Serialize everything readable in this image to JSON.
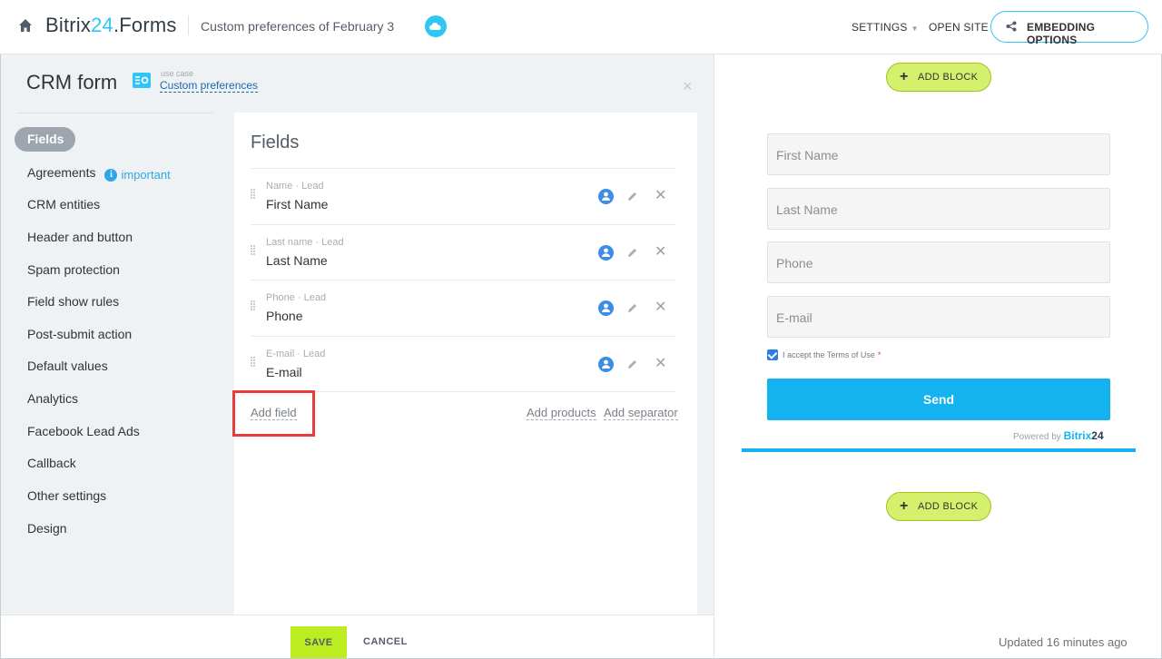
{
  "topbar": {
    "brand_main": "Bitrix",
    "brand_accent": "24",
    "brand_suffix": ".Forms",
    "doc_title": "Custom preferences of February 3",
    "settings_label": "SETTINGS",
    "open_site_label": "OPEN SITE",
    "embedding_label": "EMBEDDING OPTIONS"
  },
  "editor": {
    "title": "CRM form",
    "usecase_small": "use case",
    "usecase_link": "Custom preferences",
    "close_glyph": "×"
  },
  "nav": {
    "items": [
      {
        "label": "Fields",
        "active": true
      },
      {
        "label": "Agreements",
        "badge": "important"
      },
      {
        "label": "CRM entities"
      },
      {
        "label": "Header and button"
      },
      {
        "label": "Spam protection"
      },
      {
        "label": "Field show rules"
      },
      {
        "label": "Post-submit action"
      },
      {
        "label": "Default values"
      },
      {
        "label": "Analytics"
      },
      {
        "label": "Facebook Lead Ads"
      },
      {
        "label": "Callback"
      },
      {
        "label": "Other settings"
      },
      {
        "label": "Design"
      }
    ]
  },
  "fields_card": {
    "title": "Fields",
    "rows": [
      {
        "sub": "Name · Lead",
        "main": "First Name"
      },
      {
        "sub": "Last name · Lead",
        "main": "Last Name"
      },
      {
        "sub": "Phone · Lead",
        "main": "Phone"
      },
      {
        "sub": "E-mail · Lead",
        "main": "E-mail"
      }
    ],
    "add_field": "Add field",
    "add_products": "Add products",
    "add_separator": "Add separator"
  },
  "footer": {
    "save": "SAVE",
    "cancel": "CANCEL"
  },
  "preview": {
    "add_block": "ADD BLOCK",
    "inputs": [
      "First Name",
      "Last Name",
      "Phone",
      "E-mail"
    ],
    "terms": "I accept the Terms of Use",
    "terms_required": "*",
    "send": "Send",
    "powered_prefix": "Powered by",
    "powered_brand": "Bitrix",
    "powered_num": "24",
    "updated": "Updated 16 minutes ago",
    "terms_checked": true
  },
  "colors": {
    "accent": "#2fc6f6",
    "send": "#13b3f0",
    "save": "#bbed21",
    "add_block": "#d5f06c",
    "highlight": "#ea3b3b"
  }
}
